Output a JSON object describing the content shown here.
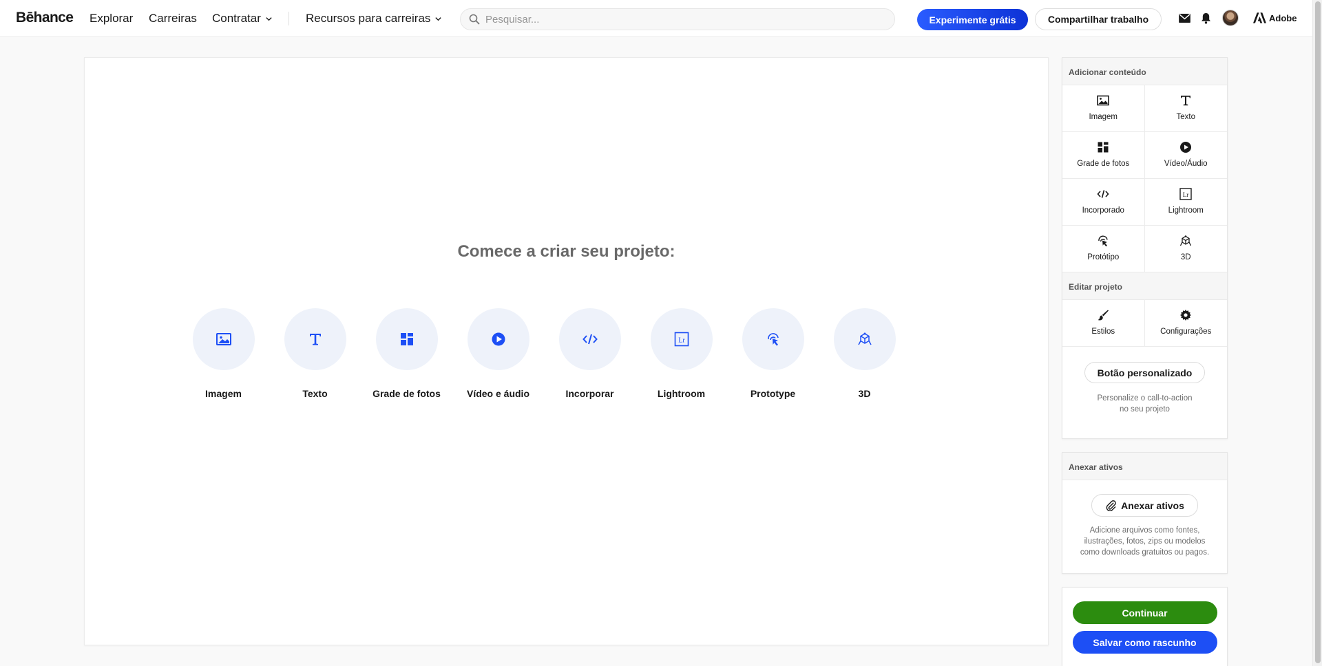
{
  "nav": {
    "logo": "Bēhance",
    "links": [
      "Explorar",
      "Carreiras",
      "Contratar",
      "Recursos para carreiras"
    ],
    "search_placeholder": "Pesquisar...",
    "try_button": "Experimente grátis",
    "share_button": "Compartilhar trabalho",
    "adobe": "Adobe",
    "accent": "#1d4ff5"
  },
  "canvas": {
    "title": "Comece a criar seu projeto:",
    "items": [
      {
        "label": "Imagem",
        "icon": "image-icon"
      },
      {
        "label": "Texto",
        "icon": "text-icon"
      },
      {
        "label": "Grade de fotos",
        "icon": "photo-grid-icon"
      },
      {
        "label": "Vídeo e áudio",
        "icon": "play-icon"
      },
      {
        "label": "Incorporar",
        "icon": "embed-icon"
      },
      {
        "label": "Lightroom",
        "icon": "lightroom-icon"
      },
      {
        "label": "Prototype",
        "icon": "prototype-icon"
      },
      {
        "label": "3D",
        "icon": "cube-icon"
      }
    ]
  },
  "sidebar": {
    "add_content": {
      "title": "Adicionar conteúdo",
      "tiles": [
        {
          "label": "Imagem",
          "icon": "image-icon"
        },
        {
          "label": "Texto",
          "icon": "text-icon"
        },
        {
          "label": "Grade de fotos",
          "icon": "photo-grid-icon"
        },
        {
          "label": "Vídeo/Áudio",
          "icon": "play-icon"
        },
        {
          "label": "Incorporado",
          "icon": "embed-icon"
        },
        {
          "label": "Lightroom",
          "icon": "lightroom-icon"
        },
        {
          "label": "Protótipo",
          "icon": "prototype-icon"
        },
        {
          "label": "3D",
          "icon": "cube-icon"
        }
      ]
    },
    "edit_project": {
      "title": "Editar projeto",
      "tiles": [
        {
          "label": "Estilos",
          "icon": "brush-icon"
        },
        {
          "label": "Configurações",
          "icon": "gear-icon"
        }
      ],
      "custom_button": "Botão personalizado",
      "custom_help": [
        "Personalize o call-to-action",
        "no seu projeto"
      ]
    },
    "attach": {
      "title": "Anexar ativos",
      "button": "Anexar ativos",
      "help": [
        "Adicione arquivos como fontes,",
        "ilustrações, fotos, zips ou modelos",
        "como downloads gratuitos ou pagos."
      ]
    },
    "actions": {
      "continue": "Continuar",
      "continue_color": "#2c8c0f",
      "draft": "Salvar como rascunho",
      "draft_color": "#1d4ff5"
    }
  }
}
